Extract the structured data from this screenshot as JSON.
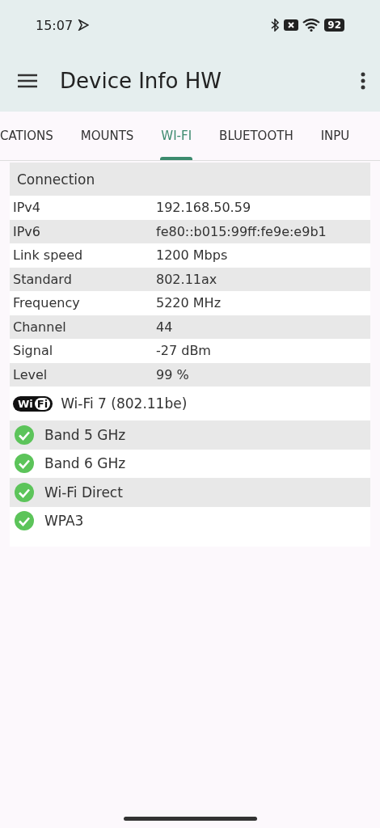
{
  "status_bar": {
    "time": "15:07",
    "battery": "92"
  },
  "app_bar": {
    "title": "Device Info HW"
  },
  "tabs": [
    {
      "label": "CATIONS",
      "selected": false
    },
    {
      "label": "MOUNTS",
      "selected": false
    },
    {
      "label": "WI-FI",
      "selected": true
    },
    {
      "label": "BLUETOOTH",
      "selected": false
    },
    {
      "label": "INPU",
      "selected": false
    }
  ],
  "section": {
    "title": "Connection"
  },
  "rows": [
    {
      "label": "IPv4",
      "value": "192.168.50.59"
    },
    {
      "label": "IPv6",
      "value": "fe80::b015:99ff:fe9e:e9b1"
    },
    {
      "label": "Link speed",
      "value": "1200 Mbps"
    },
    {
      "label": "Standard",
      "value": "802.11ax"
    },
    {
      "label": "Frequency",
      "value": "5220 MHz"
    },
    {
      "label": "Channel",
      "value": "44"
    },
    {
      "label": "Signal",
      "value": "-27 dBm"
    },
    {
      "label": "Level",
      "value": "99 %"
    }
  ],
  "standard": {
    "logo": [
      "Wi",
      "Fi"
    ],
    "label": "Wi-Fi 7 (802.11be)"
  },
  "features": [
    {
      "label": "Band 5 GHz",
      "checked": true
    },
    {
      "label": "Band 6 GHz",
      "checked": true
    },
    {
      "label": "Wi-Fi Direct",
      "checked": true
    },
    {
      "label": "WPA3",
      "checked": true
    }
  ]
}
